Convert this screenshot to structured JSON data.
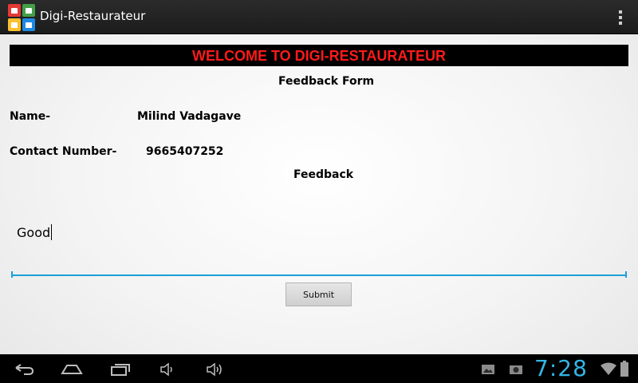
{
  "app": {
    "title": "Digi-Restaurateur"
  },
  "banner": {
    "text": "WELCOME TO DIGI-RESTAURATEUR",
    "bg": "#000000",
    "color": "#ff1a1a"
  },
  "form": {
    "heading": "Feedback Form",
    "name_label": "Name-",
    "name_value": "Milind Vadagave",
    "contact_label": "Contact Number-",
    "contact_value": "9665407252",
    "feedback_label": "Feedback",
    "feedback_value": "Good",
    "submit_label": "Submit",
    "accent": "#1aa0d8"
  },
  "statusbar": {
    "time": "7:28",
    "clock_color": "#33b5e5"
  },
  "icons": {
    "app": "restaurant-logo-icon",
    "overflow": "overflow-menu-icon",
    "back": "back-icon",
    "home": "home-icon",
    "recents": "recent-apps-icon",
    "vol_down": "volume-down-icon",
    "vol_up": "volume-up-icon",
    "gallery": "gallery-notification-icon",
    "camera": "screenshot-notification-icon",
    "wifi": "wifi-icon",
    "battery": "battery-icon"
  }
}
